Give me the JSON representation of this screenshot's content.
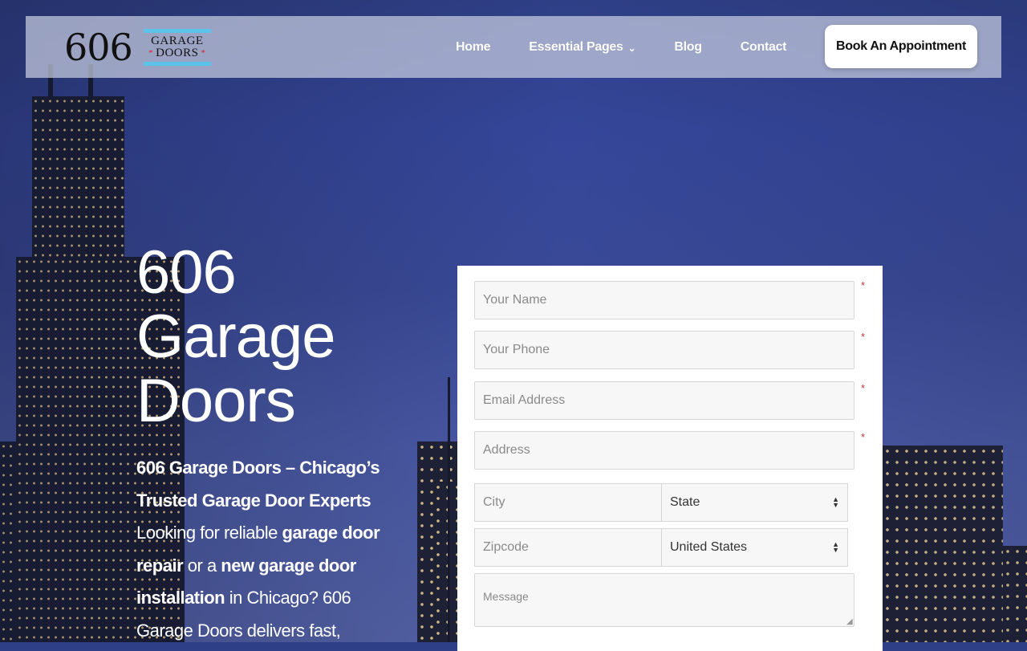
{
  "header": {
    "logo": {
      "number": "606",
      "line1": "GARAGE",
      "line2": "DOORS",
      "star": "*"
    },
    "nav": [
      {
        "label": "Home"
      },
      {
        "label": "Essential Pages",
        "has_dropdown": true
      },
      {
        "label": "Blog"
      },
      {
        "label": "Contact"
      }
    ],
    "cta_label": "Book An Appointment"
  },
  "hero": {
    "title_lines": [
      "606",
      "Garage",
      "Doors"
    ],
    "intro_bold": "606 Garage Doors – Chicago’s Trusted Garage Door Experts",
    "para": {
      "t1": "Looking for reliable ",
      "b1": "garage door repair",
      "t2": " or a ",
      "b2": "new garage door installation",
      "t3": " in Chicago? 606 Garage Doors delivers fast,"
    }
  },
  "form": {
    "name_placeholder": "Your Name",
    "phone_placeholder": "Your Phone",
    "email_placeholder": "Email Address",
    "address_placeholder": "Address",
    "city_placeholder": "City",
    "state_value": "State",
    "zip_placeholder": "Zipcode",
    "country_value": "United States",
    "message_placeholder": "Message",
    "required_mark": "*"
  },
  "colors": {
    "logo_stripe": "#5bc2ea",
    "logo_star": "#e02020",
    "required": "#c0392b"
  }
}
